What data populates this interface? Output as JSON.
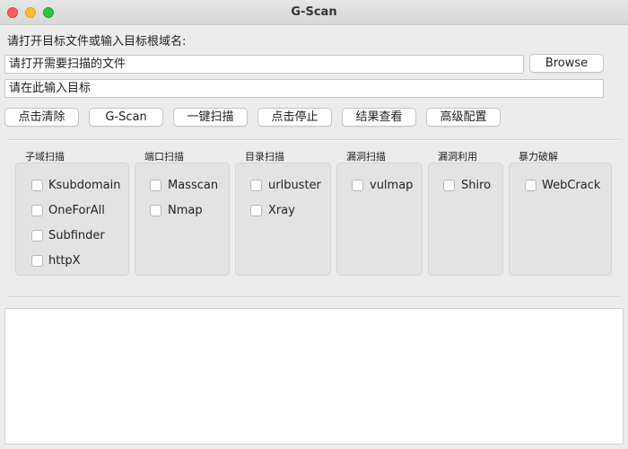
{
  "window": {
    "title": "G-Scan"
  },
  "header": {
    "prompt": "请打开目标文件或输入目标根域名:"
  },
  "inputs": {
    "file_placeholder": "请打开需要扫描的文件",
    "target_placeholder": "请在此输入目标",
    "browse_label": "Browse"
  },
  "toolbar": {
    "clear_label": "点击清除",
    "gscan_label": "G-Scan",
    "oneclick_label": "一键扫描",
    "stop_label": "点击停止",
    "results_label": "结果查看",
    "advanced_label": "高级配置"
  },
  "groups": {
    "subdomain": {
      "title": "子域扫描",
      "items": [
        "Ksubdomain",
        "OneForAll",
        "Subfinder",
        "httpX"
      ]
    },
    "port": {
      "title": "端口扫描",
      "items": [
        "Masscan",
        "Nmap"
      ]
    },
    "directory": {
      "title": "目录扫描",
      "items": [
        "urlbuster",
        "Xray"
      ]
    },
    "vuln_scan": {
      "title": "漏洞扫描",
      "items": [
        "vulmap"
      ]
    },
    "vuln_exploit": {
      "title": "漏洞利用",
      "items": [
        "Shiro"
      ]
    },
    "bruteforce": {
      "title": "暴力破解",
      "items": [
        "WebCrack"
      ]
    }
  },
  "colors": {
    "close": "#fe5f57",
    "minimize": "#febc2e",
    "maximize": "#28c840",
    "window_bg": "#ececec",
    "group_bg": "#e3e3e3"
  }
}
